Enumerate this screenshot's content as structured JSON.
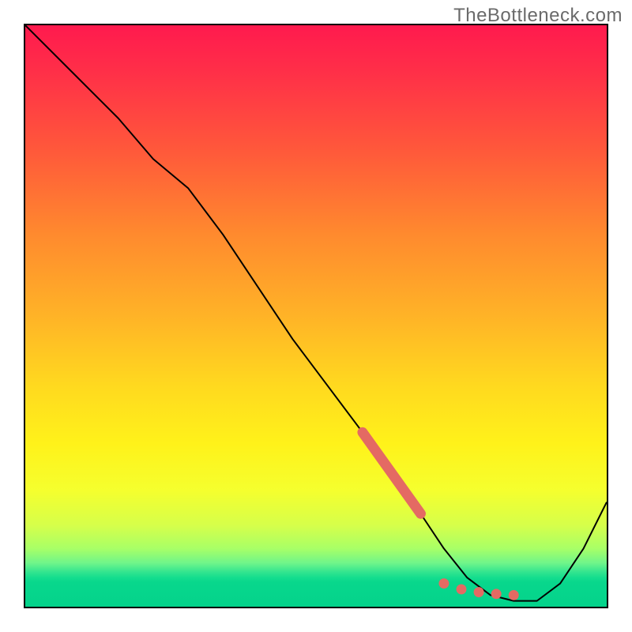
{
  "watermark": "TheBottleneck.com",
  "colors": {
    "marker": "#e46a63",
    "curve": "#000000",
    "gradient_top": "#ff1a4e",
    "gradient_bottom": "#04d38b"
  },
  "chart_data": {
    "type": "line",
    "title": "",
    "xlabel": "",
    "ylabel": "",
    "xlim": [
      0,
      100
    ],
    "ylim": [
      0,
      100
    ],
    "grid": false,
    "legend": false,
    "note": "Axes have no tick labels; values are relative 0–100 estimates read from geometry.",
    "series": [
      {
        "name": "curve",
        "x": [
          0,
          8,
          16,
          22,
          28,
          34,
          40,
          46,
          52,
          58,
          63,
          68,
          72,
          76,
          80,
          84,
          88,
          92,
          96,
          100
        ],
        "y": [
          100,
          92,
          84,
          77,
          72,
          64,
          55,
          46,
          38,
          30,
          23,
          16,
          10,
          5,
          2,
          1,
          1,
          4,
          10,
          18
        ]
      }
    ],
    "markers": {
      "accent_segment": {
        "x": [
          58,
          68
        ],
        "y": [
          30,
          16
        ]
      },
      "accent_dots": {
        "x": [
          72,
          75,
          78,
          81,
          84
        ],
        "y": [
          4,
          3,
          2.5,
          2.2,
          2
        ]
      }
    },
    "background": {
      "type": "vertical_gradient",
      "stops": [
        {
          "pos": 0,
          "color": "#ff1a4e"
        },
        {
          "pos": 36,
          "color": "#ff8a2e"
        },
        {
          "pos": 62,
          "color": "#ffd91f"
        },
        {
          "pos": 80,
          "color": "#f5ff2e"
        },
        {
          "pos": 94,
          "color": "#14dd8e"
        },
        {
          "pos": 100,
          "color": "#04d38b"
        }
      ]
    }
  }
}
